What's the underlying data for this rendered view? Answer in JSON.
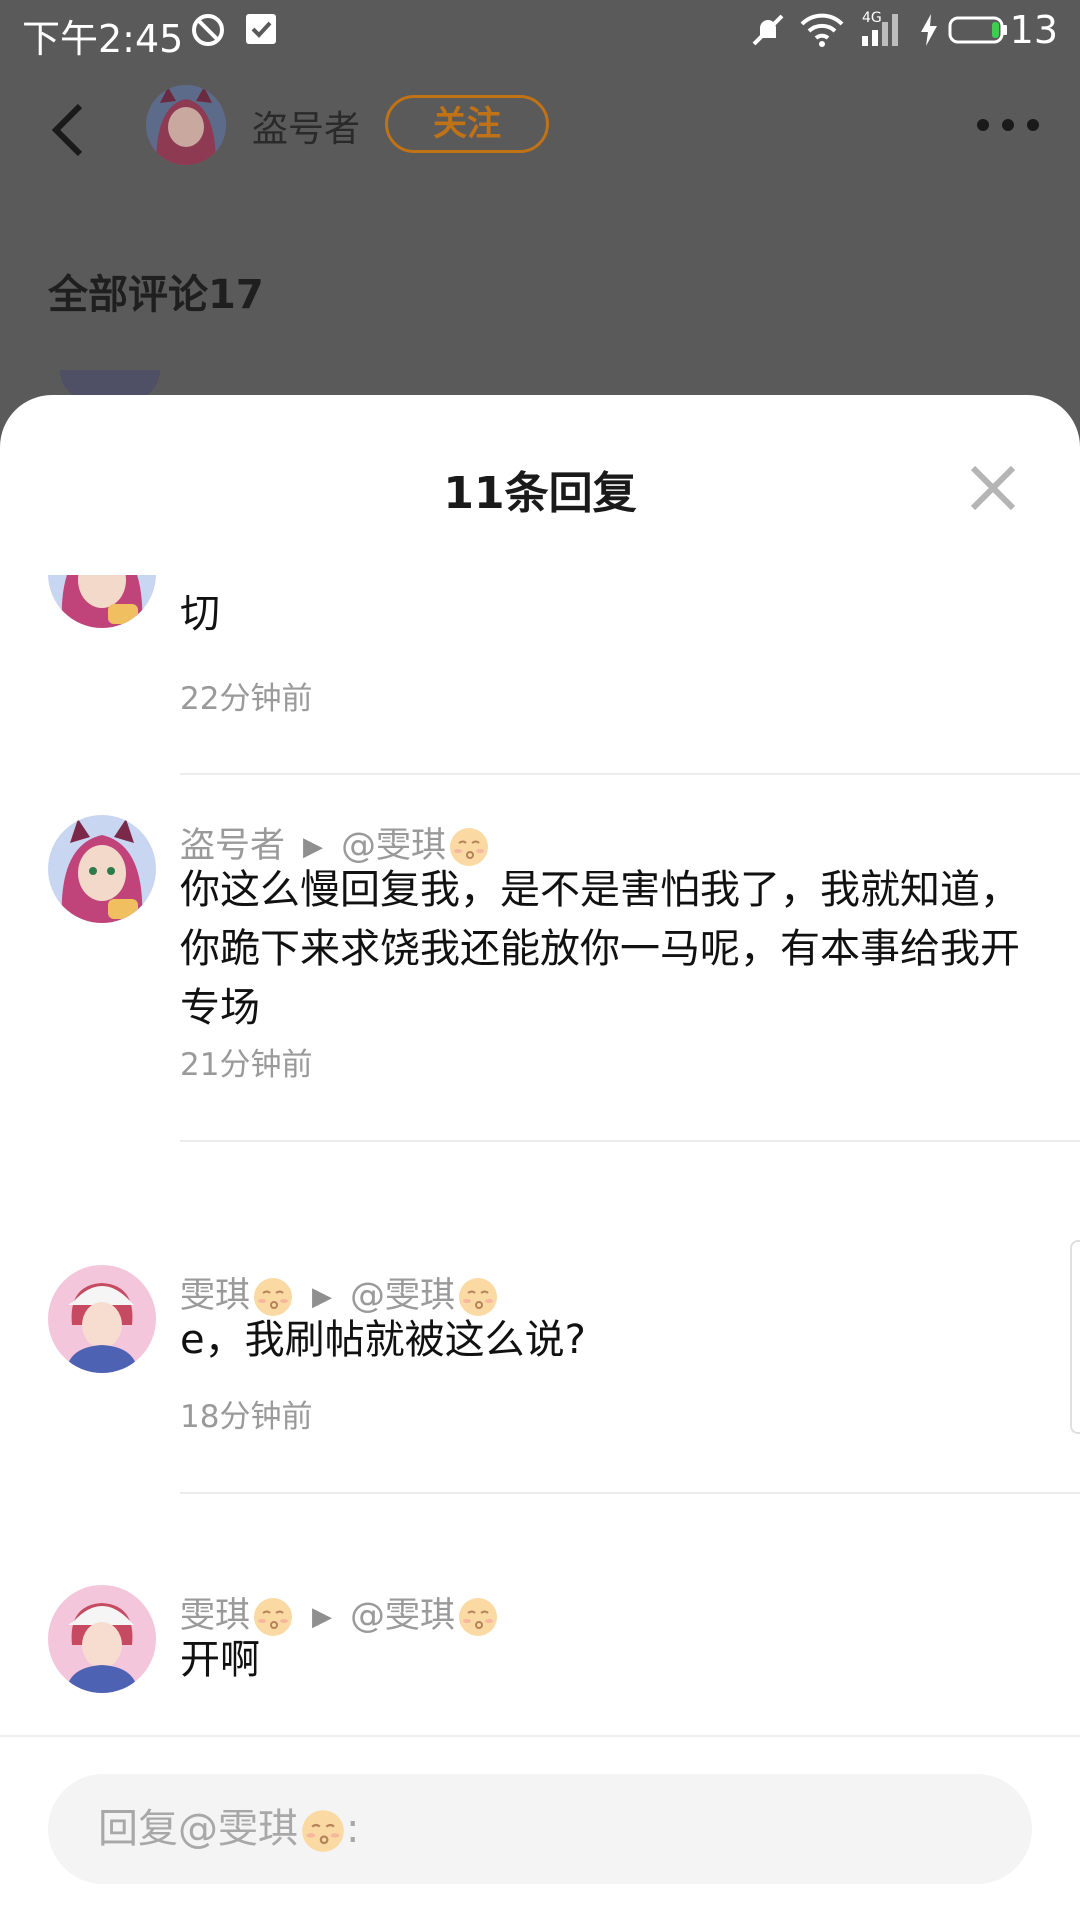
{
  "status_bar": {
    "time": "下午2:45",
    "network_label": "4G",
    "battery": "13",
    "icons": [
      "do-not-disturb-icon",
      "mail-check-icon",
      "mute-icon",
      "wifi-icon",
      "signal-icon",
      "charging-icon",
      "battery-icon"
    ]
  },
  "header": {
    "username": "盗号者",
    "follow_label": "关注",
    "section_title": "全部评论17"
  },
  "sheet": {
    "title": "11条回复"
  },
  "replies": [
    {
      "author": "",
      "reply_to": "",
      "content": "切",
      "time": "22分钟前",
      "avatar": "pink-hair-cat-ears-avatar"
    },
    {
      "author": "盗号者",
      "reply_to": "@雯琪",
      "content": "你这么慢回复我，是不是害怕我了，我就知道，你跪下来求饶我还能放你一马呢，有本事给我开专场",
      "time": "21分钟前",
      "avatar": "pink-hair-cat-ears-avatar"
    },
    {
      "author": "雯琪",
      "reply_to": "@雯琪",
      "content": "e，我刷帖就被这么说?",
      "time": "18分钟前",
      "avatar": "cap-girl-avatar"
    },
    {
      "author": "雯琪",
      "reply_to": "@雯琪",
      "content": "开啊",
      "time": "",
      "avatar": "cap-girl-avatar"
    }
  ],
  "input": {
    "placeholder": "回复@雯琪",
    "placeholder_suffix": ":"
  },
  "colors": {
    "accent": "#c07216",
    "overlay": "#5a5a5a",
    "meta_text": "#9a9a9a"
  }
}
